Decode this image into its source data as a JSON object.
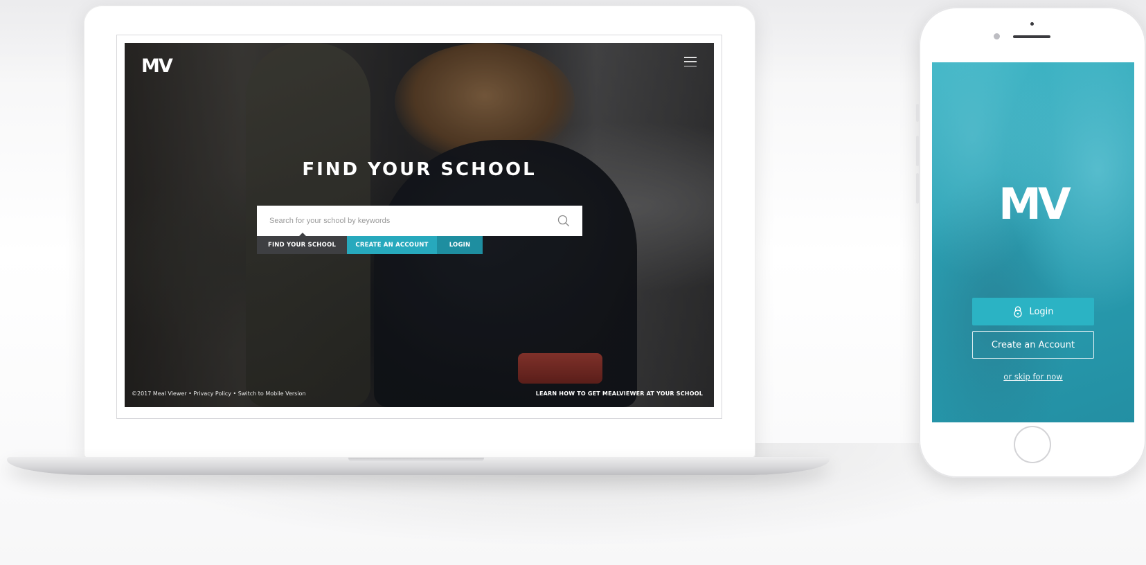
{
  "laptop": {
    "logo": "MV",
    "menu_icon": "hamburger-menu-icon",
    "title": "FIND YOUR SCHOOL",
    "search": {
      "placeholder": "Search for your school by keywords",
      "value": "",
      "icon": "search-icon"
    },
    "tabs": [
      {
        "label": "FIND YOUR SCHOOL",
        "active": true
      },
      {
        "label": "CREATE AN ACCOUNT",
        "active": false
      },
      {
        "label": "LOGIN",
        "active": false
      }
    ],
    "footer": {
      "copyright": "©2017 Meal Viewer",
      "separator": " • ",
      "privacy": "Privacy Policy",
      "mobile": "Switch to Mobile Version",
      "learn_more": "LEARN HOW TO GET MEALVIEWER AT YOUR SCHOOL"
    }
  },
  "phone": {
    "logo": "MV",
    "login_label": "Login",
    "login_icon": "lock-icon",
    "create_label": "Create an Account",
    "skip_label": "or skip for now"
  },
  "colors": {
    "accent": "#27a9bd",
    "accent_dark": "#1e8ea0",
    "tab_dark": "#3e3f42",
    "phone_teal": "#2a9fb2"
  }
}
